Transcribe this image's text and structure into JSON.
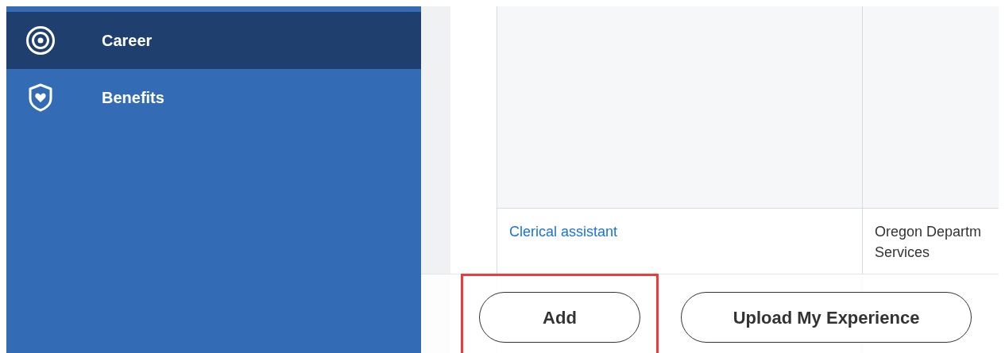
{
  "sidebar": {
    "items": [
      {
        "label": "Career",
        "kind": "target",
        "selected": true
      },
      {
        "label": "Benefits",
        "kind": "shield",
        "selected": false
      }
    ]
  },
  "table": {
    "rows": [
      {
        "job_title": "Clerical assistant",
        "employer_lines": [
          "Oregon Departm",
          "Services"
        ]
      }
    ]
  },
  "footer": {
    "buttons": [
      {
        "label": "Add",
        "highlighted": true
      },
      {
        "label": "Upload My Experience",
        "highlighted": false
      }
    ]
  }
}
